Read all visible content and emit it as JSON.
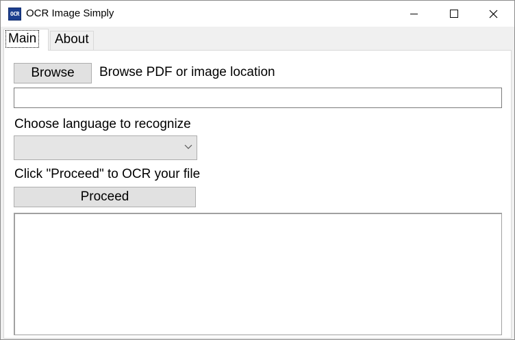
{
  "window": {
    "icon_text": "OCR",
    "title": "OCR Image Simply",
    "icon_colors": {
      "bg": "#1d3f8f",
      "fg": "#ffffff"
    },
    "controls": [
      "minimize-icon",
      "maximize-icon",
      "close-icon"
    ]
  },
  "tabs": [
    {
      "label": "Main",
      "selected": true
    },
    {
      "label": "About",
      "selected": false
    }
  ],
  "main": {
    "browse_button": "Browse",
    "browse_label": "Browse PDF or image location",
    "path_value": "",
    "language_label": "Choose language to recognize",
    "language_selected": "",
    "proceed_label": "Click \"Proceed\" to OCR your file",
    "proceed_button": "Proceed",
    "output_text": ""
  }
}
